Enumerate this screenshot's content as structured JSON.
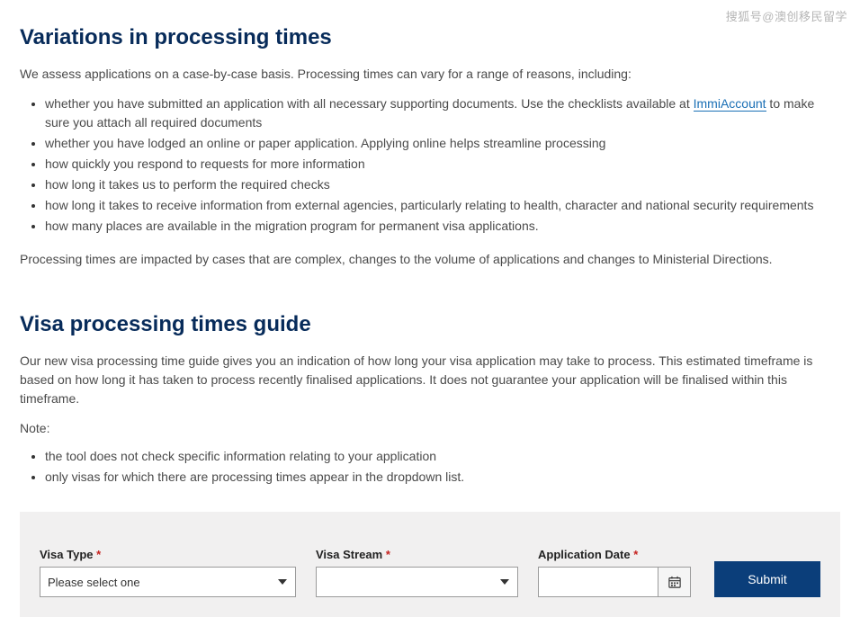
{
  "watermark": "搜狐号@澳创移民留学",
  "section1": {
    "heading": "Variations in processing times",
    "intro": "We assess applications on a case-by-case basis. Processing times can vary for a range of reasons, including:",
    "bullets": {
      "b1a": "whether you have submitted an application with all necessary supporting documents. Use the checklists available at ",
      "b1_link": "ImmiAccount",
      "b1b": " to make sure you attach all required documents",
      "b2": "whether you have lodged an online or paper application. Applying online helps streamline processing",
      "b3": "how quickly you respond to requests for more information",
      "b4": "how long it takes us to perform the required checks",
      "b5": "how long it takes to receive information from external agencies, particularly relating to health, character and national security requirements",
      "b6": "how many places are available in the migration program for permanent visa applications."
    },
    "outro": "Processing times are impacted by cases that are complex, changes to the volume of applications and changes to Ministerial Directions."
  },
  "section2": {
    "heading": "Visa processing times guide",
    "intro": "Our new visa processing time guide gives you an indication of how long your visa application may take to process. This estimated timeframe is based on how long it has taken to process recently finalised applications. It does not guarantee your application will be finalised within this timeframe.",
    "note_label": "Note:",
    "bullets": {
      "b1": "the tool does not check specific information relating to your application",
      "b2": "only visas for which there are processing times appear in the dropdown list."
    }
  },
  "form": {
    "visa_type_label": "Visa Type ",
    "visa_type_placeholder": "Please select one",
    "visa_stream_label": "Visa Stream ",
    "app_date_label": "Application Date ",
    "required_mark": "*",
    "submit_label": "Submit"
  }
}
